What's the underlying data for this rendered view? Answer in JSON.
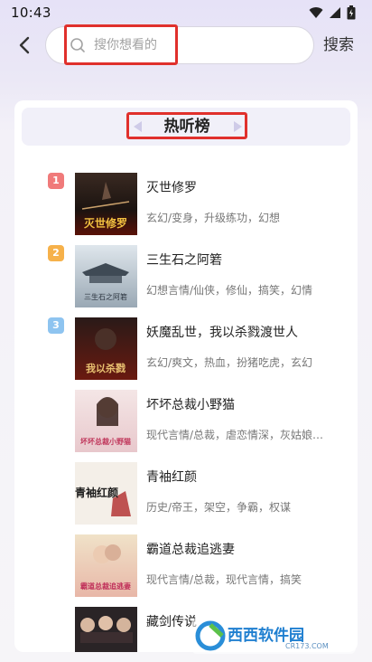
{
  "status_bar": {
    "time": "10:43"
  },
  "header": {
    "search_placeholder": "搜你想看的",
    "search_button": "搜索"
  },
  "card": {
    "title": "热听榜"
  },
  "books": [
    {
      "rank": "1",
      "rank_color": "#f07a7a",
      "title": "灭世修罗",
      "tags": "玄幻/变身，升级练功，幻想",
      "cover_text": "灭世修罗"
    },
    {
      "rank": "2",
      "rank_color": "#f6b14a",
      "title": "三生石之阿箬",
      "tags": "幻想言情/仙侠，修仙，搞笑，幻情",
      "cover_text": "三生石之阿箬"
    },
    {
      "rank": "3",
      "rank_color": "#8ec4f0",
      "title": "妖魔乱世，我以杀戮渡世人",
      "tags": "玄幻/爽文，热血，扮猪吃虎，玄幻",
      "cover_text": "我以杀戮"
    },
    {
      "rank": "",
      "rank_color": "",
      "title": "坏坏总裁小野猫",
      "tags": "现代言情/总裁，虐恋情深，灰姑娘…",
      "cover_text": "坏坏总裁小野猫"
    },
    {
      "rank": "",
      "rank_color": "",
      "title": "青袖红颜",
      "tags": "历史/帝王，架空，争霸，权谋",
      "cover_text": "青袖红颜"
    },
    {
      "rank": "",
      "rank_color": "",
      "title": "霸道总裁追逃妻",
      "tags": "现代言情/总裁，现代言情，搞笑",
      "cover_text": "霸道总裁追逃妻"
    },
    {
      "rank": "",
      "rank_color": "",
      "title": "藏剑传说",
      "tags": "",
      "cover_text": ""
    }
  ],
  "watermark": {
    "text": "西西软件园",
    "sub": "CR173.COM"
  },
  "colors": {
    "annotation": "#e0302c",
    "accent_bg": "#f1f0f9"
  }
}
